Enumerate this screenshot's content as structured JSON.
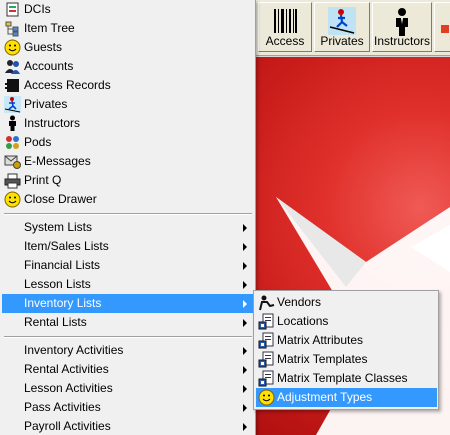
{
  "toolbar": {
    "buttons": [
      {
        "label": "Access",
        "icon": "barcode-icon"
      },
      {
        "label": "Privates",
        "icon": "skier-icon"
      },
      {
        "label": "Instructors",
        "icon": "instructor-icon"
      }
    ]
  },
  "menu": {
    "top_items": [
      {
        "label": "DCIs",
        "icon": "dci-icon"
      },
      {
        "label": "Item Tree",
        "icon": "tree-icon"
      },
      {
        "label": "Guests",
        "icon": "smiley-icon"
      },
      {
        "label": "Accounts",
        "icon": "accounts-icon"
      },
      {
        "label": "Access Records",
        "icon": "access-icon"
      },
      {
        "label": "Privates",
        "icon": "skier-icon"
      },
      {
        "label": "Instructors",
        "icon": "instructor-icon"
      },
      {
        "label": "Pods",
        "icon": "pods-icon"
      },
      {
        "label": "E-Messages",
        "icon": "email-icon"
      },
      {
        "label": "Print Q",
        "icon": "printer-icon"
      },
      {
        "label": "Close Drawer",
        "icon": "smiley-icon"
      }
    ],
    "list_items": [
      {
        "label": "System Lists"
      },
      {
        "label": "Item/Sales Lists"
      },
      {
        "label": "Financial Lists"
      },
      {
        "label": "Lesson Lists"
      },
      {
        "label": "Inventory Lists"
      },
      {
        "label": "Rental Lists"
      }
    ],
    "activity_items": [
      {
        "label": "Inventory Activities"
      },
      {
        "label": "Rental Activities"
      },
      {
        "label": "Lesson Activities"
      },
      {
        "label": "Pass Activities"
      },
      {
        "label": "Payroll Activities"
      }
    ]
  },
  "submenu": {
    "items": [
      {
        "label": "Vendors",
        "icon": "vendor-icon"
      },
      {
        "label": "Locations",
        "icon": "list-icon"
      },
      {
        "label": "Matrix Attributes",
        "icon": "list-icon"
      },
      {
        "label": "Matrix Templates",
        "icon": "list-icon"
      },
      {
        "label": "Matrix Template Classes",
        "icon": "list-icon"
      },
      {
        "label": "Adjustment Types",
        "icon": "smiley-icon"
      }
    ]
  },
  "colors": {
    "highlight": "#3399ff",
    "menu_bg": "#f0f0f0",
    "canvas_red": "#d42a26"
  }
}
